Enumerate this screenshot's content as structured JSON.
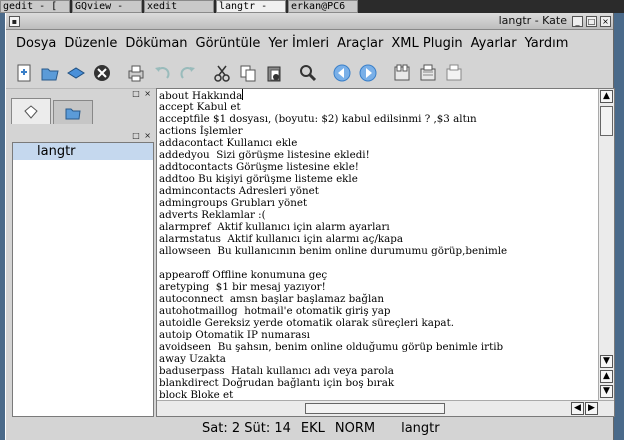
{
  "taskbar": {
    "tasks": [
      "gedit - [",
      "GQview -",
      "xedit",
      "langtr -",
      "erkan@PC6"
    ]
  },
  "window": {
    "title": "langtr - Kate",
    "icon_glyph": "▪",
    "buttons": [
      "_",
      "□",
      "×"
    ]
  },
  "menu": [
    "Dosya",
    "Düzenle",
    "Döküman",
    "Görüntüle",
    "Yer İmleri",
    "Araçlar",
    "XML Plugin",
    "Ayarlar",
    "Yardım"
  ],
  "toolbar": {
    "icons": [
      "new-document-icon",
      "open-document-icon",
      "save-icon",
      "close-document-icon",
      "print-icon",
      "undo-icon",
      "redo-icon",
      "cut-icon",
      "copy-icon",
      "paste-icon",
      "find-icon",
      "back-icon",
      "forward-icon",
      "window-split-icon",
      "window-stack-icon",
      "window-close-icon"
    ],
    "accent": "#3a7fc8"
  },
  "left_panel": {
    "dock_buttons": "□ ×",
    "tabs": [
      "file-list-tab",
      "file-selector-tab"
    ],
    "files": [
      "langtr"
    ]
  },
  "editor": {
    "lines": [
      "about Hakkında",
      "accept Kabul et",
      "acceptfile $1 dosyası, (boyutu: $2) kabul edilsinmi ? ,$3 altın",
      "actions İşlemler",
      "addacontact Kullanıcı ekle",
      "addedyou  Sizi görüşme listesine ekledi!",
      "addtocontacts Görüşme listesine ekle!",
      "addtoo Bu kişiyi görüşme listeme ekle",
      "admincontacts Adresleri yönet",
      "admingroups Grubları yönet",
      "adverts Reklamlar :(",
      "alarmpref  Aktif kullanıcı için alarm ayarları",
      "alarmstatus  Aktif kullanıcı için alarmı aç/kapa",
      "allowseen  Bu kullanıcının benim online durumumu görüp,benimle",
      "",
      "appearoff Offline konumuna geç",
      "aretyping  $1 bir mesaj yazıyor!",
      "autoconnect  amsn başlar başlamaz bağlan",
      "autohotmaillog  hotmail'e otomatik giriş yap",
      "autoidle Gereksiz yerde otomatik olarak süreçleri kapat.",
      "autoip Otomatik IP numarası",
      "avoidseen  Bu şahsın, benim online olduğumu görüp benimle irtib",
      "away Uzakta",
      "baduserpass  Hatalı kullanıcı adı veya parola",
      "blankdirect Doğrudan bağlantı için boş bırak",
      "block Bloke et"
    ]
  },
  "scrollbars": {
    "up": "▲",
    "down": "▼",
    "down2": "▼",
    "up2": "▲",
    "left": "◀",
    "right": "▶"
  },
  "statusbar": {
    "position": "Sat: 2 Süt: 14",
    "insert_mode": "EKL",
    "selection_mode": "NORM",
    "filename": "langtr"
  }
}
